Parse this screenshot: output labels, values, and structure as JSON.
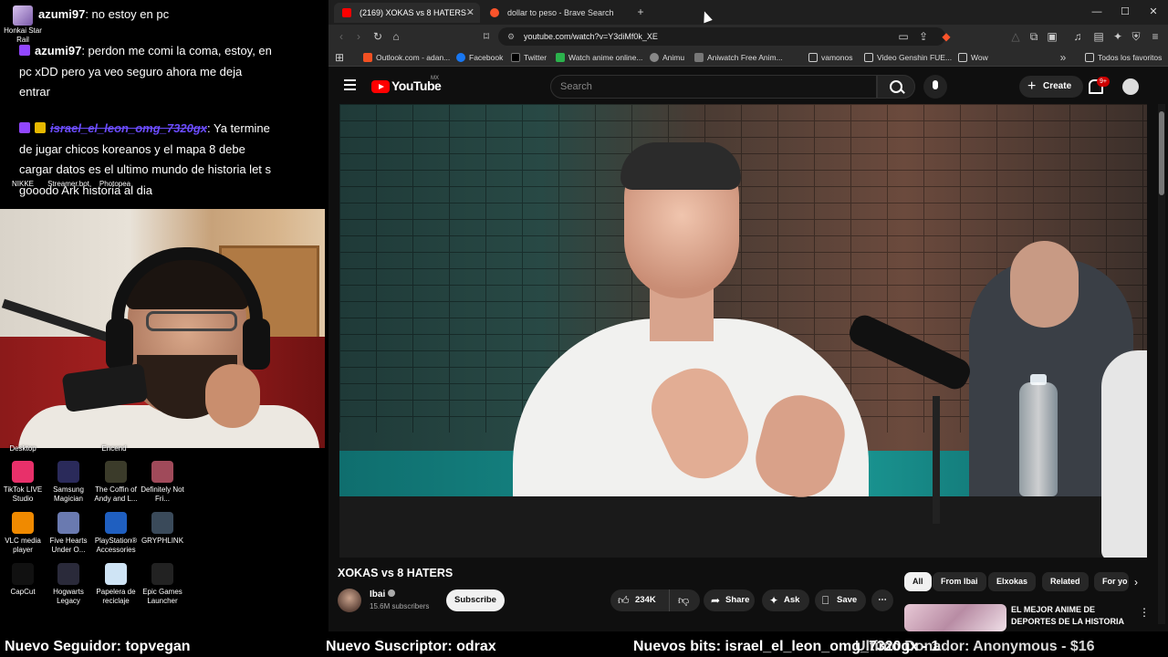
{
  "overlay": {
    "chat": [
      {
        "user": "azumi97",
        "text": ": no estoy en pc"
      },
      {
        "user": "azumi97",
        "text": ": perdon me comi la coma, estoy, en pc xDD pero ya veo seguro ahora me deja entrar"
      },
      {
        "user": "israel_el_leon_omg_7320gx",
        "text": ": Ya termine de jugar chicos koreanos y el mapa 8 debe cargar datos es el ultimo mundo de historia let s gooodo Ark historia al dia"
      }
    ],
    "top_desktop_labels": [
      "Honkai Star Rail",
      "NIKKE",
      "Streamer.bot",
      "Photopea"
    ],
    "partial_labels": [
      "Desktop",
      "Encend"
    ],
    "desktop_icons": [
      {
        "label": "TikTok LIVE Studio",
        "icon": "tiktok-icon",
        "color": "#e8306a"
      },
      {
        "label": "Samsung Magician",
        "icon": "samsung-magician-icon",
        "color": "#2a2a5a"
      },
      {
        "label": "The Coffin of Andy and L...",
        "icon": "game-icon",
        "color": "#3b3b2a"
      },
      {
        "label": "Definitely Not Fri...",
        "icon": "game-icon",
        "color": "#a04a5a"
      },
      {
        "label": "VLC media player",
        "icon": "vlc-icon",
        "color": "#f08a00"
      },
      {
        "label": "Five Hearts Under O...",
        "icon": "game-icon",
        "color": "#6a7ab0"
      },
      {
        "label": "PlayStation® Accessories",
        "icon": "playstation-icon",
        "color": "#1f5fc0"
      },
      {
        "label": "GRYPHLINK",
        "icon": "gryphlink-icon",
        "color": "#3a4a5a"
      },
      {
        "label": "CapCut",
        "icon": "capcut-icon",
        "color": "#111111"
      },
      {
        "label": "Hogwarts Legacy",
        "icon": "game-icon",
        "color": "#2a2a3a"
      },
      {
        "label": "Papelera de reciclaje",
        "icon": "recycle-bin-icon",
        "color": "#cfe4f5"
      },
      {
        "label": "Epic Games Launcher",
        "icon": "epic-games-icon",
        "color": "#222222"
      }
    ]
  },
  "browser": {
    "tabs": [
      {
        "title": "(2169) XOKAS vs 8 HATERS -",
        "active": true
      },
      {
        "title": "dollar to peso - Brave Search",
        "active": false
      }
    ],
    "url": "youtube.com/watch?v=Y3diMf0k_XE",
    "bookmarks": [
      "Outlook.com - adan...",
      "Facebook",
      "Twitter",
      "Watch anime online...",
      "Animu",
      "Aniwatch Free Anim...",
      "vamonos",
      "Video Genshin FUE...",
      "Wow",
      "Todos los favoritos"
    ],
    "window_controls": [
      "—",
      "☐",
      "✕"
    ]
  },
  "youtube": {
    "logo_text": "YouTube",
    "region": "MX",
    "search_placeholder": "Search",
    "create_label": "Create",
    "notifications": "9+",
    "video_title": "XOKAS vs 8 HATERS",
    "channel": "Ibai",
    "subscribers": "15.6M subscribers",
    "subscribe_label": "Subscribe",
    "likes": "234K",
    "share_label": "Share",
    "ask_label": "Ask",
    "save_label": "Save",
    "chips": [
      "All",
      "From Ibai",
      "Elxokas",
      "Related",
      "For yo"
    ],
    "recommended": {
      "title": "EL MEJOR ANIME DE DEPORTES DE LA HISTORIA"
    }
  },
  "ticker": [
    "Nuevo Seguidor: topvegan",
    "Nuevo Suscriptor: odrax",
    "Nuevos bits: israel_el_leon_omg_7320gx - 1",
    "Ultimo Donador: Anonymous - $16"
  ]
}
